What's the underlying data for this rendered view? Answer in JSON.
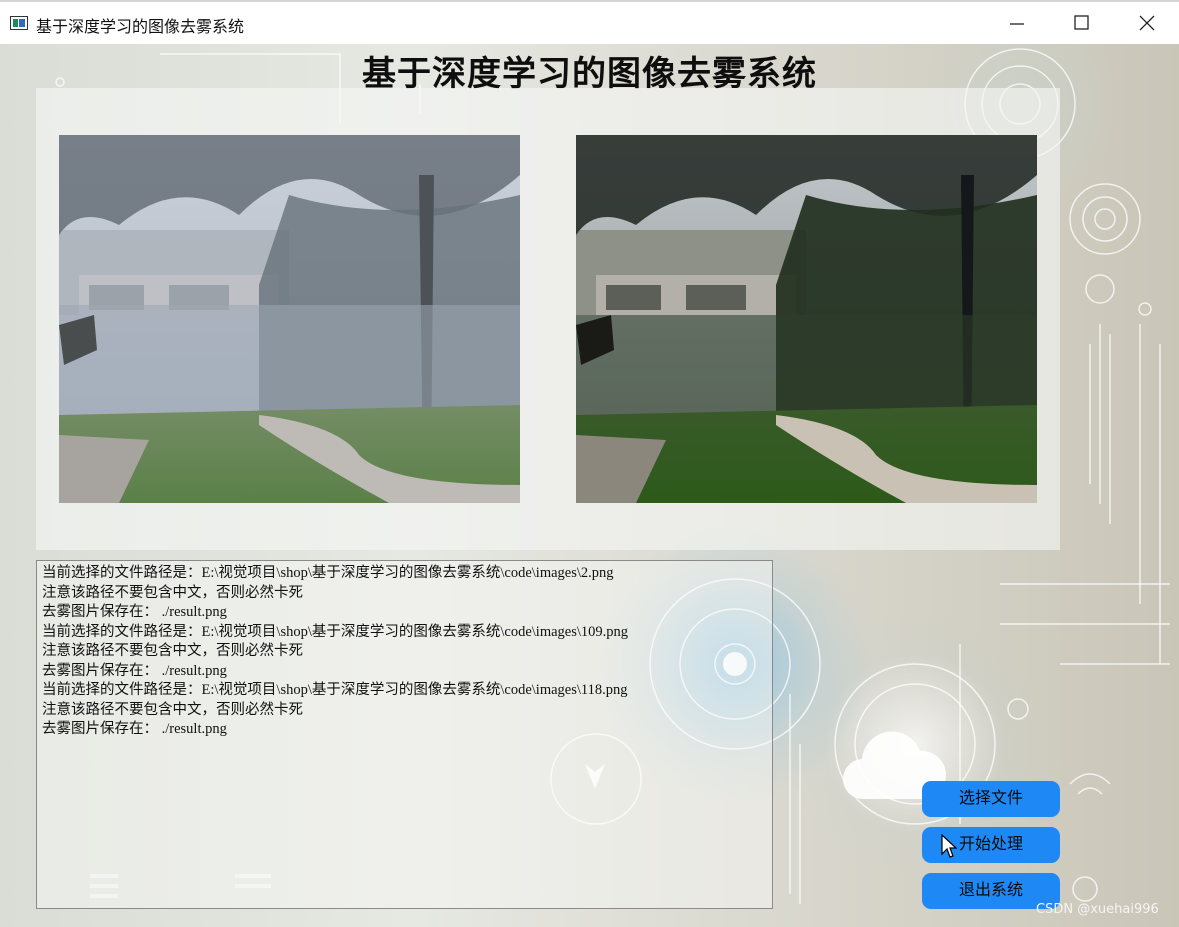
{
  "window": {
    "title": "基于深度学习的图像去雾系统"
  },
  "app": {
    "title": "基于深度学习的图像去雾系统"
  },
  "images": {
    "original_icon": "foggy-photo",
    "result_icon": "dehazed-photo"
  },
  "log": {
    "lines": [
      "当前选择的文件路径是：E:\\视觉项目\\shop\\基于深度学习的图像去雾系统\\code\\images\\2.png",
      "注意该路径不要包含中文，否则必然卡死",
      "去雾图片保存在： ./result.png",
      "当前选择的文件路径是：E:\\视觉项目\\shop\\基于深度学习的图像去雾系统\\code\\images\\109.png",
      "注意该路径不要包含中文，否则必然卡死",
      "去雾图片保存在： ./result.png",
      "当前选择的文件路径是：E:\\视觉项目\\shop\\基于深度学习的图像去雾系统\\code\\images\\118.png",
      "注意该路径不要包含中文，否则必然卡死",
      "去雾图片保存在： ./result.png"
    ]
  },
  "buttons": {
    "select_file": "选择文件",
    "start_process": "开始处理",
    "exit_system": "退出系统"
  },
  "watermark": "CSDN @xuehai996",
  "colors": {
    "button": "#1e88f5",
    "title_bar": "#ffffff"
  }
}
